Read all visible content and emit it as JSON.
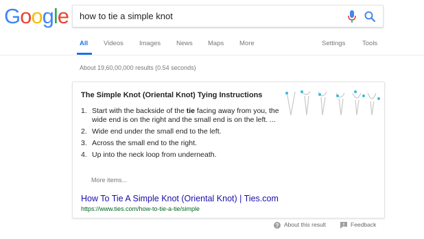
{
  "logo": {
    "letters": [
      "G",
      "o",
      "o",
      "g",
      "l",
      "e"
    ],
    "colors": [
      "#4285F4",
      "#EA4335",
      "#FBBC05",
      "#4285F4",
      "#34A853",
      "#EA4335"
    ]
  },
  "search": {
    "query": "how to tie a simple knot"
  },
  "tabs": [
    {
      "label": "All"
    },
    {
      "label": "Videos"
    },
    {
      "label": "Images"
    },
    {
      "label": "News"
    },
    {
      "label": "Maps"
    },
    {
      "label": "More"
    },
    {
      "label": "Settings"
    },
    {
      "label": "Tools"
    }
  ],
  "stats": "About 19,60,00,000 results (0.54 seconds)",
  "snippet": {
    "title": "The Simple Knot (Oriental Knot) Tying Instructions",
    "steps": [
      {
        "num": "1.",
        "before": "Start with the backside of the ",
        "bold": "tie",
        "after": " facing away from you, the wide end is on the right and the small end is on the left. ..."
      },
      {
        "num": "2.",
        "text": "Wide end under the small end to the left."
      },
      {
        "num": "3.",
        "text": "Across the small end to the right."
      },
      {
        "num": "4.",
        "text": "Up into the neck loop from underneath."
      }
    ],
    "more_items": "More items...",
    "link_text": "How To Tie A Simple Knot (Oriental Knot) | Ties.com",
    "url": "https://www.ties.com/how-to-tie-a-tie/simple"
  },
  "footer": {
    "about": "About this result",
    "feedback": "Feedback"
  },
  "colors": {
    "accent": "#1a73e8",
    "link": "#1a0dab",
    "url": "#006621",
    "mic_red": "#EA4335",
    "knot_dot": "#35b9e0"
  },
  "icons": [
    "microphone-icon",
    "search-icon",
    "help-icon",
    "feedback-icon"
  ]
}
